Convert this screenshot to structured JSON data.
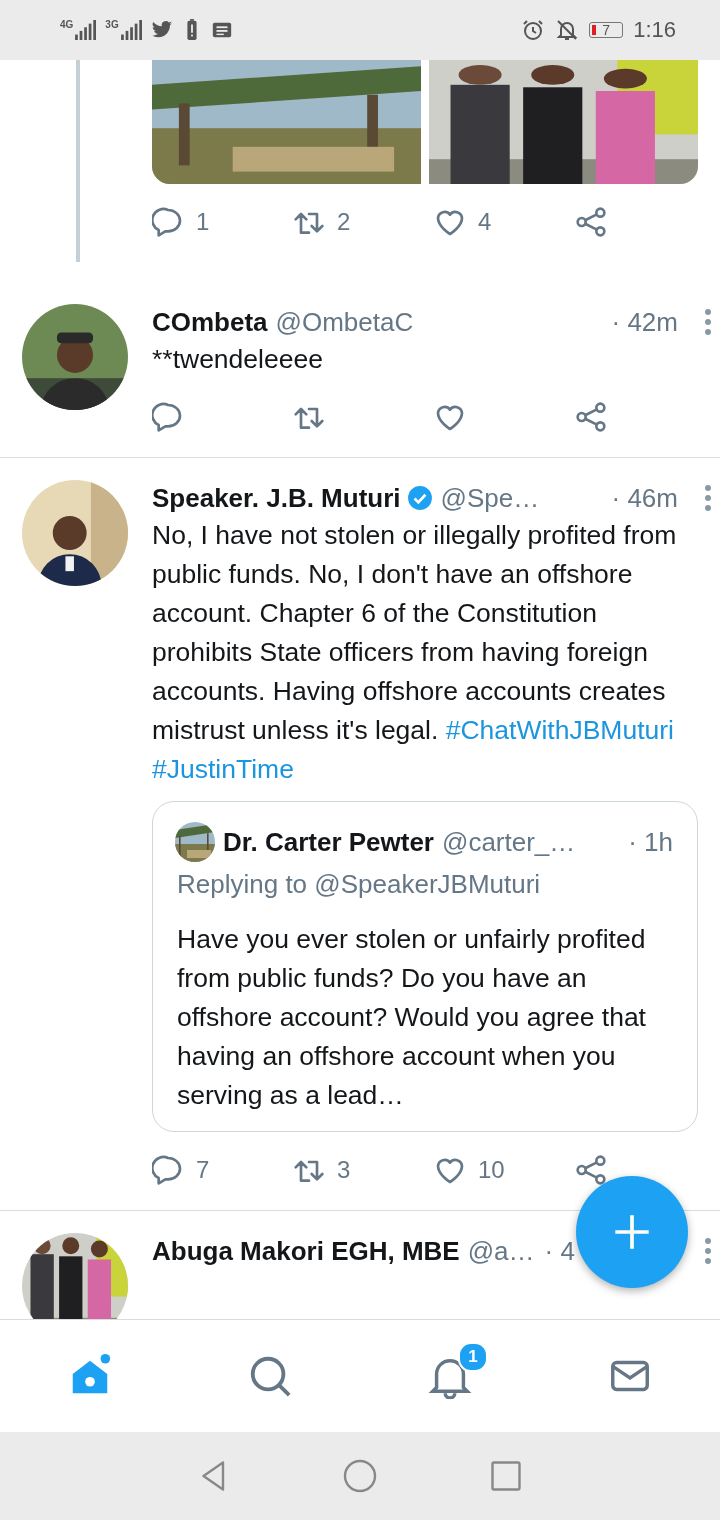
{
  "status_bar": {
    "networks": [
      "4G",
      "3G"
    ],
    "battery": "7",
    "time": "1:16"
  },
  "tweets": [
    {
      "kind": "partial",
      "thread": true,
      "actions": [
        {
          "kind": "reply",
          "count": "1"
        },
        {
          "kind": "retweet",
          "count": "2"
        },
        {
          "kind": "like",
          "count": "4"
        },
        {
          "kind": "share"
        }
      ]
    },
    {
      "kind": "full",
      "user": {
        "name": "COmbeta",
        "handle": "@OmbetaC",
        "verified": false
      },
      "time": "· 42m",
      "body": [
        {
          "kind": "text",
          "text": "**twendeleeee"
        }
      ],
      "actions": [
        {
          "kind": "reply"
        },
        {
          "kind": "retweet"
        },
        {
          "kind": "like"
        },
        {
          "kind": "share"
        }
      ]
    },
    {
      "kind": "full",
      "user": {
        "name": "Speaker. J.B. Muturi",
        "handle": "@Spe…",
        "verified": true
      },
      "time": "· 46m",
      "body": [
        {
          "kind": "text",
          "text": "No, I have not stolen or illegally profited from public funds. No, I don't have an offshore account. Chapter 6 of the Constitution prohibits State officers from having foreign accounts. Having offshore accounts creates mistrust unless it's legal. "
        },
        {
          "kind": "hashtag",
          "text": "#ChatWithJBMuturi"
        },
        {
          "kind": "hashtag",
          "text": "#JustinTime"
        }
      ],
      "quote": {
        "name": "Dr. Carter Pewter",
        "handle": "@carter_…",
        "time": "· 1h",
        "replying_to": "Replying to @SpeakerJBMuturi",
        "text": "Have you ever stolen or unfairly profited from public funds? Do you have an offshore account? Would you agree that having an offshore account when you serving as a lead…"
      },
      "actions": [
        {
          "kind": "reply",
          "count": "7"
        },
        {
          "kind": "retweet",
          "count": "3"
        },
        {
          "kind": "like",
          "count": "10"
        },
        {
          "kind": "share"
        }
      ]
    },
    {
      "kind": "full",
      "user": {
        "name": "Abuga Makori EGH, MBE",
        "handle": "@a…",
        "verified": false
      },
      "time": "· 4"
    }
  ],
  "bottom_nav": [
    {
      "kind": "home",
      "selected": true,
      "new_content": true
    },
    {
      "kind": "search",
      "selected": false
    },
    {
      "kind": "notifications",
      "selected": false,
      "badge": "1"
    },
    {
      "kind": "messages",
      "selected": false
    }
  ]
}
